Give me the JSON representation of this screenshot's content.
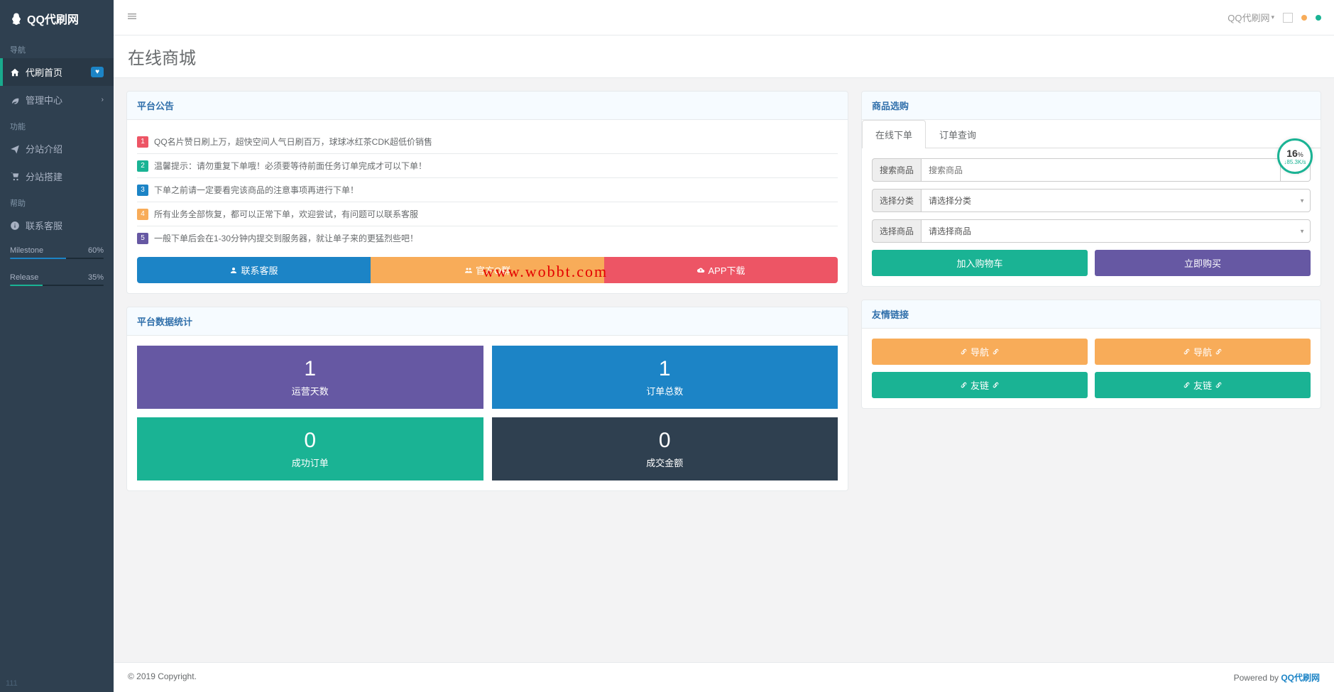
{
  "brand": "QQ代刷网",
  "page_title": "在线商城",
  "nav_header_name": "QQ代刷网",
  "sidebar": {
    "sections": [
      {
        "label": "导航",
        "items": [
          {
            "label": "代刷首页",
            "active": true,
            "badge": "♥",
            "icon": "home"
          },
          {
            "label": "管理中心",
            "icon": "leaf",
            "chevron": true
          }
        ]
      },
      {
        "label": "功能",
        "items": [
          {
            "label": "分站介绍",
            "icon": "plane"
          },
          {
            "label": "分站搭建",
            "icon": "cart"
          }
        ]
      },
      {
        "label": "帮助",
        "items": [
          {
            "label": "联系客服",
            "icon": "info"
          }
        ]
      }
    ],
    "progress": [
      {
        "label": "Milestone",
        "value": "60%",
        "pct": 60,
        "color": "blue"
      },
      {
        "label": "Release",
        "value": "35%",
        "pct": 35,
        "color": "green"
      }
    ],
    "footer": "111"
  },
  "announce": {
    "title": "平台公告",
    "items": [
      "QQ名片赞日刷上万，超快空间人气日刷百万，球球冰红茶CDK超低价销售",
      "温馨提示：请勿重复下单哦！必须要等待前面任务订单完成才可以下单！",
      "下单之前请一定要看完该商品的注意事项再进行下单！",
      "所有业务全部恢复，都可以正常下单，欢迎尝试，有问题可以联系客服",
      "一般下单后会在1-30分钟内提交到服务器，就让单子来的更猛烈些吧！"
    ],
    "buttons": [
      "联系客服",
      "官方Q群",
      "APP下载"
    ]
  },
  "stats": {
    "title": "平台数据统计",
    "cards": [
      {
        "value": "1",
        "label": "运营天数",
        "color": "purple"
      },
      {
        "value": "1",
        "label": "订单总数",
        "color": "blue"
      },
      {
        "value": "0",
        "label": "成功订单",
        "color": "green"
      },
      {
        "value": "0",
        "label": "成交金额",
        "color": "dark"
      }
    ]
  },
  "order": {
    "title": "商品选购",
    "tabs": [
      "在线下单",
      "订单查询"
    ],
    "search_label": "搜索商品",
    "search_placeholder": "搜索商品",
    "cat_label": "选择分类",
    "cat_placeholder": "请选择分类",
    "product_label": "选择商品",
    "product_placeholder": "请选择商品",
    "cart_btn": "加入购物车",
    "buy_btn": "立即购买"
  },
  "links": {
    "title": "友情链接",
    "items": [
      "导航",
      "导航",
      "友链",
      "友链"
    ]
  },
  "footer": {
    "left": "© 2019 Copyright.",
    "right_pre": "Powered by ",
    "right_link": "QQ代刷网"
  },
  "watermark": "www.wobbt.com",
  "gauge": {
    "num": "16",
    "unit": "%",
    "rate": "↓85.3K/s"
  }
}
